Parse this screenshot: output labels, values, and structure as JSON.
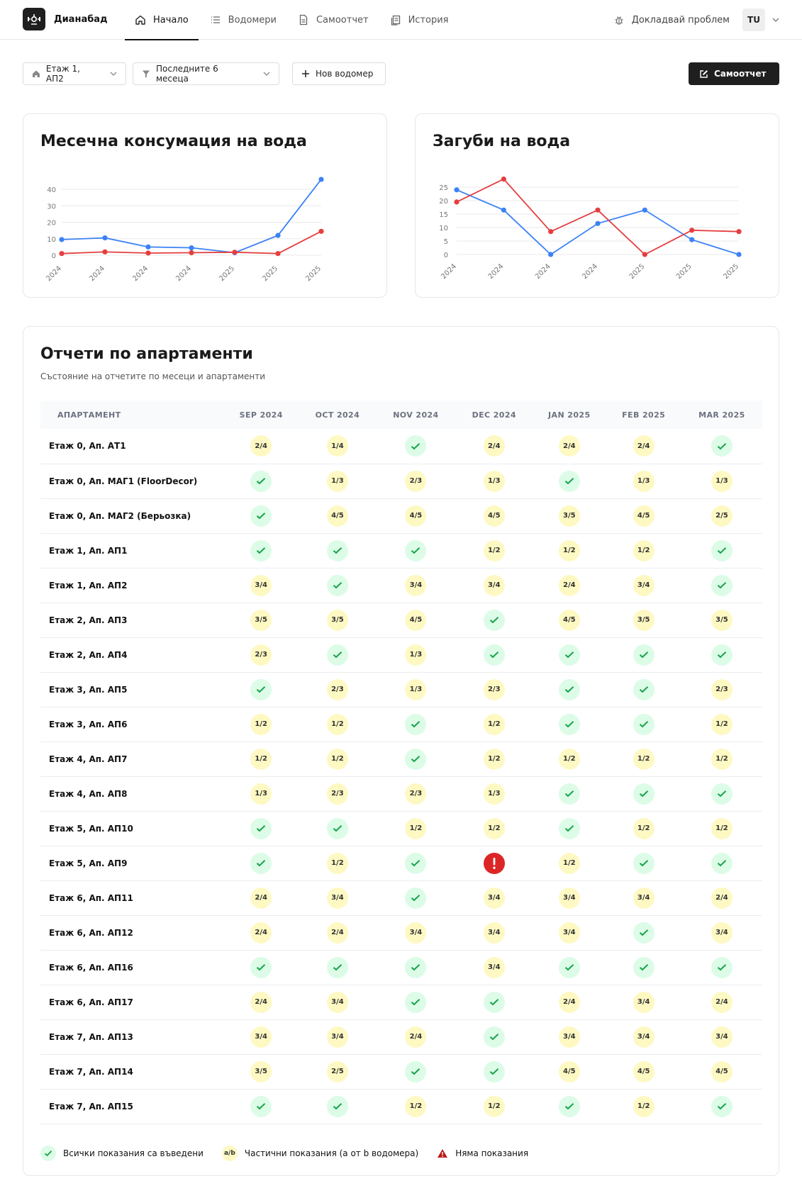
{
  "nav": {
    "brand": "Дианабад",
    "tabs": [
      {
        "label": "Начало",
        "icon": "home-icon",
        "active": true
      },
      {
        "label": "Водомери",
        "icon": "list-icon",
        "active": false
      },
      {
        "label": "Самоотчет",
        "icon": "document-icon",
        "active": false
      },
      {
        "label": "История",
        "icon": "history-icon",
        "active": false
      }
    ],
    "report_problem": "Докладвай проблем",
    "user_initials": "TU"
  },
  "toolbar": {
    "apartment_filter": "Етаж 1, АП2",
    "period_filter": "Последните 6 месеца",
    "new_meter": "Нов водомер",
    "self_report": "Самоотчет"
  },
  "consumption_chart": {
    "title": "Месечна консумация на вода",
    "chart_data": {
      "type": "line",
      "x": [
        "2024",
        "2024",
        "2024",
        "2024",
        "2025",
        "2025",
        "2025"
      ],
      "ylim": [
        0,
        40
      ],
      "yticks": [
        0,
        10,
        20,
        30,
        40
      ],
      "grid": true,
      "series": [
        {
          "color": "#3b82f6",
          "values": [
            9.5,
            10.5,
            5,
            4.5,
            1.5,
            12,
            46
          ]
        },
        {
          "color": "#e53e3e",
          "values": [
            1,
            2,
            1.3,
            1.5,
            1.8,
            1,
            14.5
          ]
        }
      ]
    }
  },
  "losses_chart": {
    "title": "Загуби на вода",
    "chart_data": {
      "type": "line",
      "x": [
        "2024",
        "2024",
        "2024",
        "2024",
        "2025",
        "2025",
        "2025"
      ],
      "ylim": [
        0,
        25
      ],
      "yticks": [
        0,
        5,
        10,
        15,
        20,
        25
      ],
      "grid": true,
      "series": [
        {
          "color": "#3b82f6",
          "values": [
            24,
            16.5,
            0,
            11.5,
            16.5,
            5.5,
            0
          ]
        },
        {
          "color": "#e53e3e",
          "values": [
            19.5,
            28,
            8.5,
            16.5,
            0,
            9,
            8.5
          ]
        }
      ]
    }
  },
  "reports": {
    "title": "Отчети по апартаменти",
    "subtitle": "Състояние на отчетите по месеци и апартаменти",
    "header_apartment": "АПАРТАМЕНТ",
    "months": [
      "SEP 2024",
      "OCT 2024",
      "NOV 2024",
      "DEC 2024",
      "JAN 2025",
      "FEB 2025",
      "MAR 2025"
    ],
    "rows": [
      {
        "name": "Етаж 0, Ап. АТ1",
        "cells": [
          "2/4",
          "1/4",
          "ok",
          "2/4",
          "2/4",
          "2/4",
          "ok"
        ]
      },
      {
        "name": "Етаж 0, Ап. МАГ1 (FloorDecor)",
        "cells": [
          "ok",
          "1/3",
          "2/3",
          "1/3",
          "ok",
          "1/3",
          "1/3"
        ]
      },
      {
        "name": "Етаж 0, Ап. МАГ2 (Берьозка)",
        "cells": [
          "ok",
          "4/5",
          "4/5",
          "4/5",
          "3/5",
          "4/5",
          "2/5"
        ]
      },
      {
        "name": "Етаж 1, Ап. АП1",
        "cells": [
          "ok",
          "ok",
          "ok",
          "1/2",
          "1/2",
          "1/2",
          "ok"
        ]
      },
      {
        "name": "Етаж 1, Ап. АП2",
        "cells": [
          "3/4",
          "ok",
          "3/4",
          "3/4",
          "2/4",
          "3/4",
          "ok"
        ]
      },
      {
        "name": "Етаж 2, Ап. АП3",
        "cells": [
          "3/5",
          "3/5",
          "4/5",
          "ok",
          "4/5",
          "3/5",
          "3/5"
        ]
      },
      {
        "name": "Етаж 2, Ап. АП4",
        "cells": [
          "2/3",
          "ok",
          "1/3",
          "ok",
          "ok",
          "ok",
          "ok"
        ]
      },
      {
        "name": "Етаж 3, Ап. АП5",
        "cells": [
          "ok",
          "2/3",
          "1/3",
          "2/3",
          "ok",
          "ok",
          "2/3"
        ]
      },
      {
        "name": "Етаж 3, Ап. АП6",
        "cells": [
          "1/2",
          "1/2",
          "ok",
          "1/2",
          "ok",
          "ok",
          "1/2"
        ]
      },
      {
        "name": "Етаж 4, Ап. АП7",
        "cells": [
          "1/2",
          "1/2",
          "ok",
          "1/2",
          "1/2",
          "1/2",
          "1/2"
        ]
      },
      {
        "name": "Етаж 4, Ап. АП8",
        "cells": [
          "1/3",
          "2/3",
          "2/3",
          "1/3",
          "ok",
          "ok",
          "ok"
        ]
      },
      {
        "name": "Етаж 5, Ап. АП10",
        "cells": [
          "ok",
          "ok",
          "1/2",
          "1/2",
          "ok",
          "1/2",
          "1/2"
        ]
      },
      {
        "name": "Етаж 5, Ап. АП9",
        "cells": [
          "ok",
          "1/2",
          "ok",
          "none",
          "1/2",
          "ok",
          "ok"
        ]
      },
      {
        "name": "Етаж 6, Ап. АП11",
        "cells": [
          "2/4",
          "3/4",
          "ok",
          "3/4",
          "3/4",
          "3/4",
          "2/4"
        ]
      },
      {
        "name": "Етаж 6, Ап. АП12",
        "cells": [
          "2/4",
          "2/4",
          "3/4",
          "3/4",
          "3/4",
          "ok",
          "3/4"
        ]
      },
      {
        "name": "Етаж 6, Ап. АП16",
        "cells": [
          "ok",
          "ok",
          "ok",
          "3/4",
          "ok",
          "ok",
          "ok"
        ]
      },
      {
        "name": "Етаж 6, Ап. АП17",
        "cells": [
          "2/4",
          "3/4",
          "ok",
          "ok",
          "2/4",
          "3/4",
          "2/4"
        ]
      },
      {
        "name": "Етаж 7, Ап. АП13",
        "cells": [
          "3/4",
          "3/4",
          "2/4",
          "ok",
          "3/4",
          "3/4",
          "3/4"
        ]
      },
      {
        "name": "Етаж 7, Ап. АП14",
        "cells": [
          "3/5",
          "2/5",
          "ok",
          "ok",
          "4/5",
          "4/5",
          "4/5"
        ]
      },
      {
        "name": "Етаж 7, Ап. АП15",
        "cells": [
          "ok",
          "ok",
          "1/2",
          "1/2",
          "ok",
          "1/2",
          "ok"
        ]
      }
    ],
    "legend": {
      "all": "Всички показания са въведени",
      "partial_badge": "a/b",
      "partial": "Частични показания (a от b водомера)",
      "none": "Няма показания"
    }
  }
}
